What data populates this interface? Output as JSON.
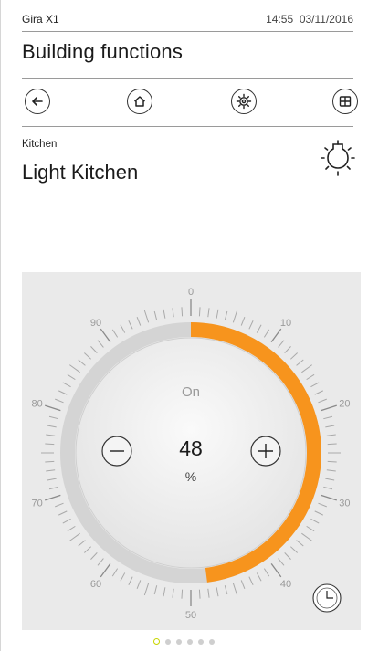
{
  "status": {
    "app_name": "Gira X1",
    "time": "14:55",
    "date": "03/11/2016"
  },
  "page": {
    "title": "Building functions"
  },
  "nav": [
    {
      "id": "back",
      "icon": "arrow-left-icon"
    },
    {
      "id": "home",
      "icon": "home-icon"
    },
    {
      "id": "settings",
      "icon": "gear-icon"
    },
    {
      "id": "grid",
      "icon": "grid-icon"
    }
  ],
  "function": {
    "room": "Kitchen",
    "title": "Light Kitchen",
    "icon": "light-bulb-icon"
  },
  "dimmer": {
    "state_label": "On",
    "value": "48",
    "unit": "%",
    "level": 48,
    "scale_labels": [
      "0",
      "10",
      "20",
      "30",
      "40",
      "50",
      "60",
      "70",
      "80",
      "90"
    ],
    "accent_color": "#f7941d",
    "track_color": "#d4d4d4",
    "minus_icon": "minus-icon",
    "plus_icon": "plus-icon",
    "timer_icon": "clock-icon"
  },
  "pager": {
    "count": 6,
    "active": 0
  }
}
